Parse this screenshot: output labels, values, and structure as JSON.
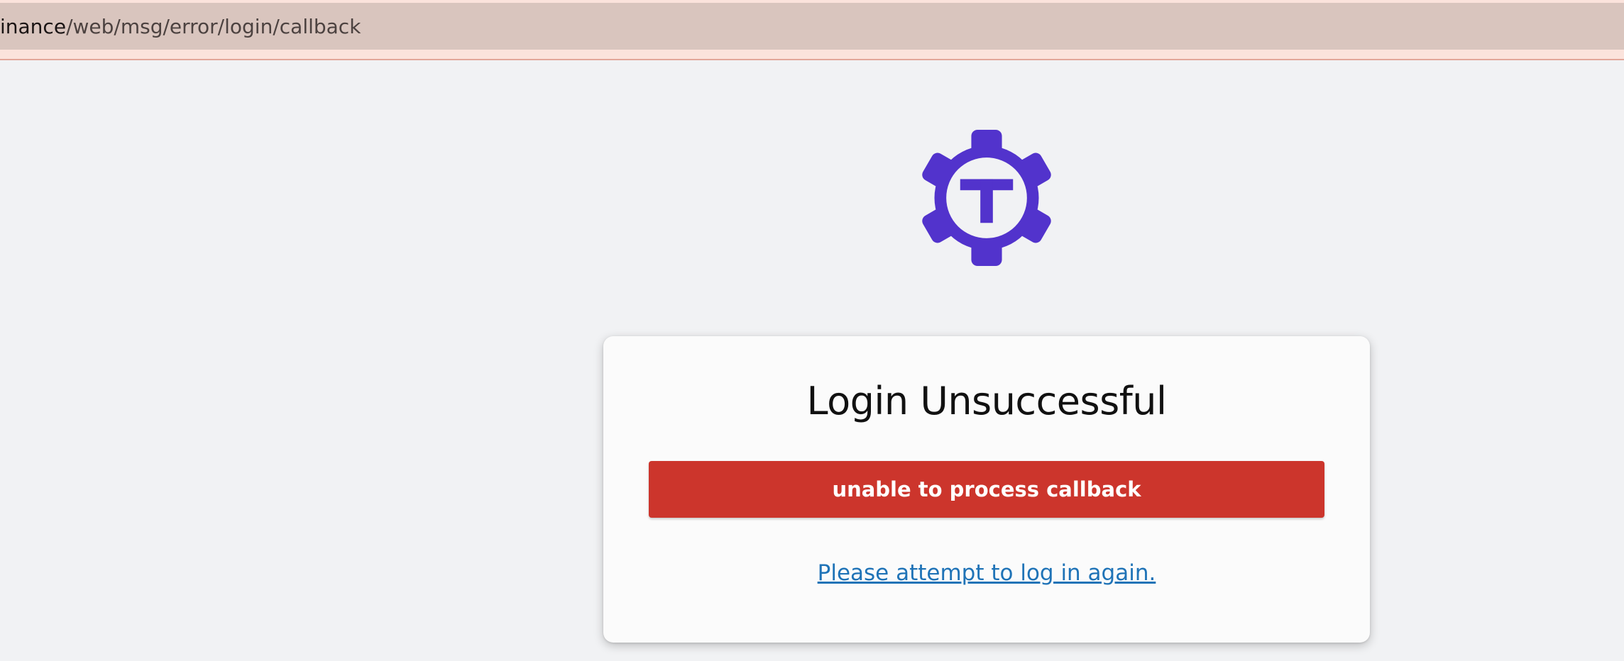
{
  "browser": {
    "url_host_fragment": "inance",
    "url_path": "/web/msg/error/login/callback"
  },
  "logo": {
    "icon": "gear-t-logo-icon",
    "letter": "T",
    "color": "#5233cc"
  },
  "card": {
    "title": "Login Unsuccessful",
    "error_message": "unable to process callback",
    "error_color": "#cc352c",
    "retry_link": "Please attempt to log in again.",
    "link_color": "#1f73b7"
  }
}
